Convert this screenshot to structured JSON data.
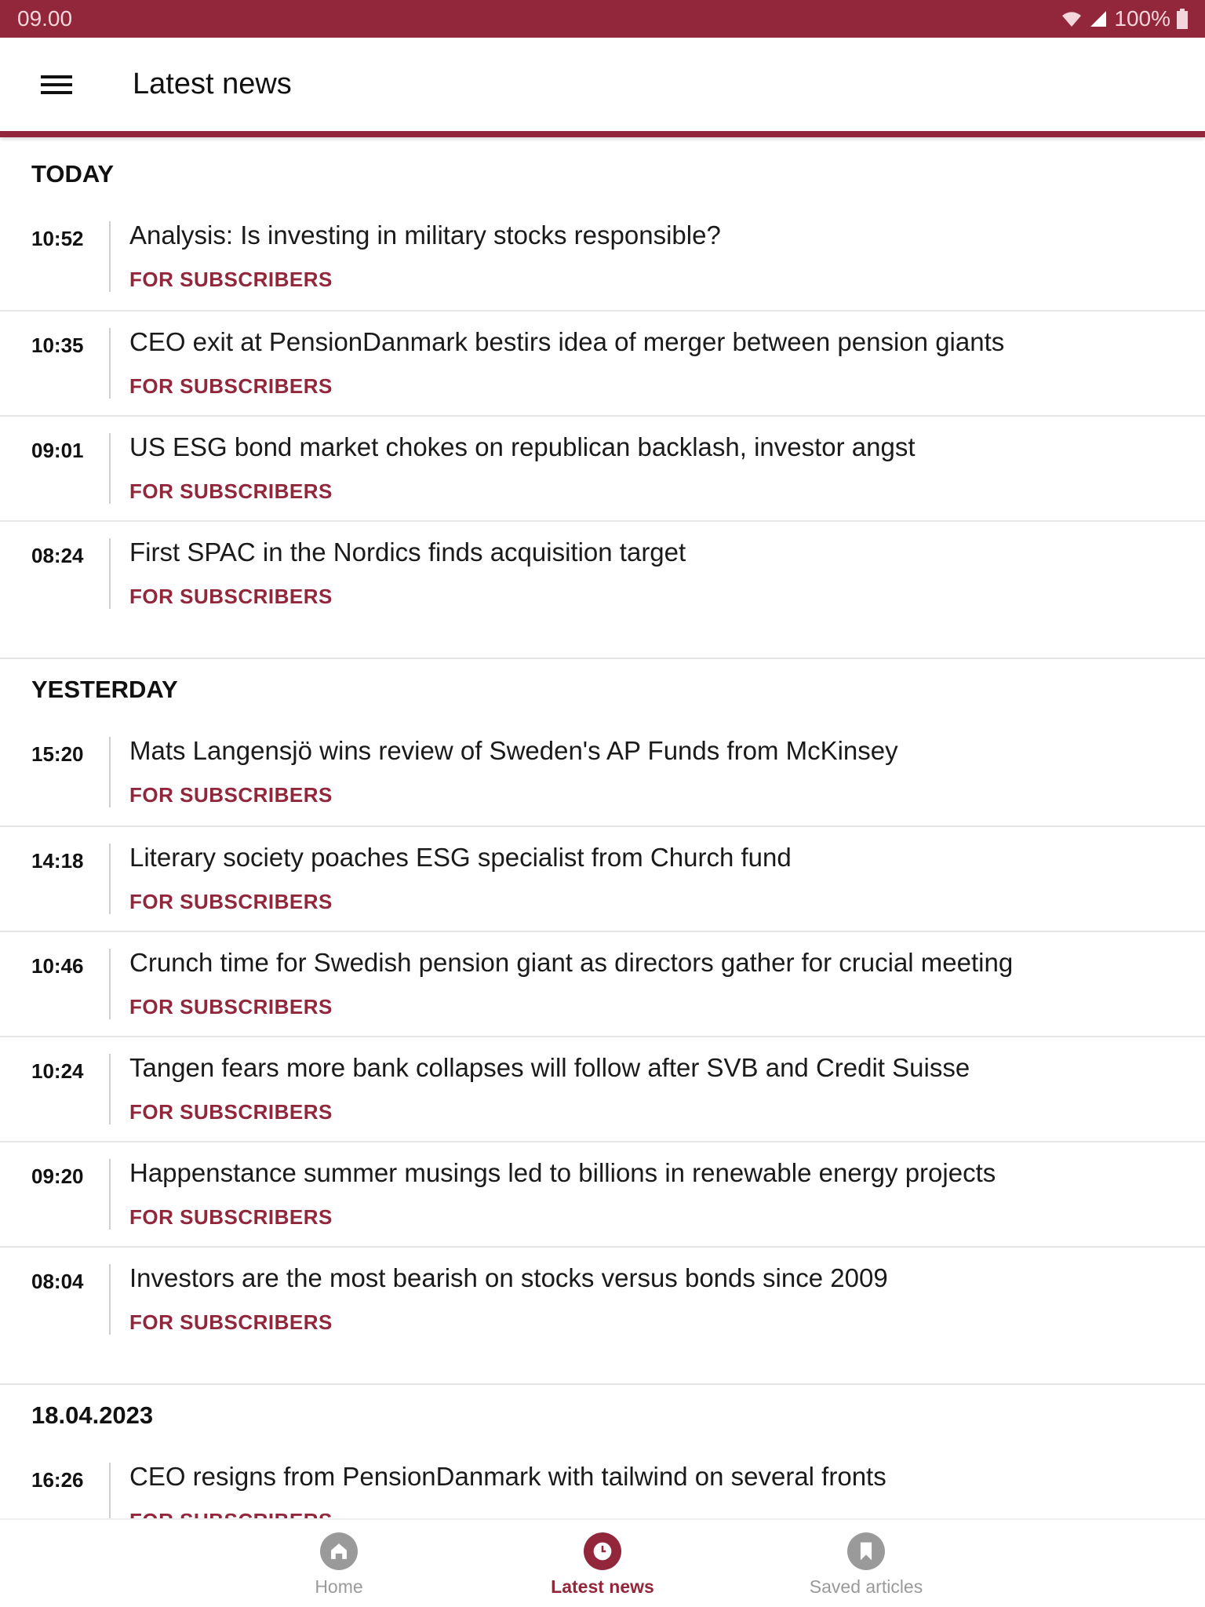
{
  "status_bar": {
    "time": "09.00",
    "battery": "100%"
  },
  "app_bar": {
    "title": "Latest news",
    "menu_icon": "hamburger-icon"
  },
  "colors": {
    "accent": "#92263a",
    "inactive": "#9a9a9a"
  },
  "sections": [
    {
      "label": "TODAY",
      "items": [
        {
          "time": "10:52",
          "title": "Analysis: Is investing in military stocks responsible?",
          "tag": "FOR SUBSCRIBERS"
        },
        {
          "time": "10:35",
          "title": "CEO exit at PensionDanmark bestirs idea of merger between pension giants",
          "tag": "FOR SUBSCRIBERS"
        },
        {
          "time": "09:01",
          "title": "US ESG bond market chokes on republican backlash, investor angst",
          "tag": "FOR SUBSCRIBERS"
        },
        {
          "time": "08:24",
          "title": "First SPAC in the Nordics finds acquisition target",
          "tag": "FOR SUBSCRIBERS"
        }
      ]
    },
    {
      "label": "YESTERDAY",
      "items": [
        {
          "time": "15:20",
          "title": "Mats Langensjö wins review of Sweden's AP Funds from McKinsey",
          "tag": "FOR SUBSCRIBERS"
        },
        {
          "time": "14:18",
          "title": "Literary society poaches ESG specialist from Church fund",
          "tag": "FOR SUBSCRIBERS"
        },
        {
          "time": "10:46",
          "title": "Crunch time for Swedish pension giant as directors gather for crucial meeting",
          "tag": "FOR SUBSCRIBERS"
        },
        {
          "time": "10:24",
          "title": "Tangen fears more bank collapses will follow after SVB and Credit Suisse",
          "tag": "FOR SUBSCRIBERS"
        },
        {
          "time": "09:20",
          "title": "Happenstance summer musings led to billions in renewable energy projects",
          "tag": "FOR SUBSCRIBERS"
        },
        {
          "time": "08:04",
          "title": "Investors are the most bearish on stocks versus bonds since 2009",
          "tag": "FOR SUBSCRIBERS"
        }
      ]
    },
    {
      "label": "18.04.2023",
      "items": [
        {
          "time": "16:26",
          "title": "CEO resigns from PensionDanmark with tailwind on several fronts",
          "tag": "FOR SUBSCRIBERS"
        }
      ]
    }
  ],
  "bottom_nav": [
    {
      "label": "Home",
      "icon": "home-icon",
      "active": false
    },
    {
      "label": "Latest news",
      "icon": "clock-icon",
      "active": true
    },
    {
      "label": "Saved articles",
      "icon": "bookmark-icon",
      "active": false
    }
  ]
}
